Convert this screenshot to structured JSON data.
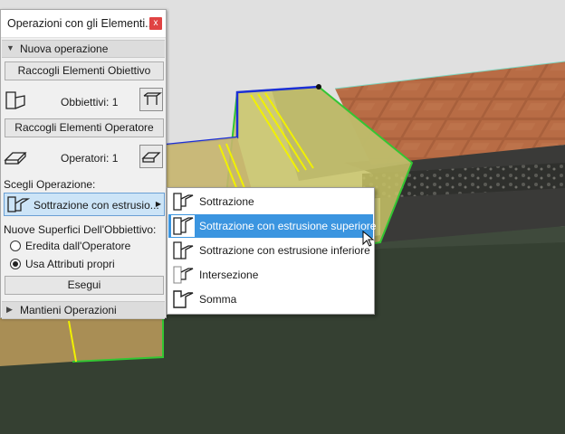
{
  "palette": {
    "title": "Operazioni con gli Elementi...",
    "close_glyph": "x",
    "section_new": "Nuova operazione",
    "collect_targets_button": "Raccogli Elementi Obiettivo",
    "targets_label": "Obbiettivi: 1",
    "collect_operators_button": "Raccogli Elementi Operatore",
    "operators_label": "Operatori: 1",
    "choose_operation_label": "Scegli Operazione:",
    "operation_selected": "Sottrazione con estrusio...",
    "new_surfaces_label": "Nuove Superfici Dell'Obbiettivo:",
    "radio_inherit": "Eredita dall'Operatore",
    "radio_own": "Usa Attributi propri",
    "radio_selected": "own",
    "execute_button": "Esegui",
    "section_keep": "Mantieni Operazioni"
  },
  "menu": {
    "items": [
      {
        "label": "Sottrazione",
        "icon": "subtraction-icon"
      },
      {
        "label": "Sottrazione con estrusione superiore",
        "icon": "subtraction-upward-extrusion-icon"
      },
      {
        "label": "Sottrazione con estrusione inferiore",
        "icon": "subtraction-downward-extrusion-icon"
      },
      {
        "label": "Intersezione",
        "icon": "intersection-icon"
      },
      {
        "label": "Somma",
        "icon": "union-icon"
      }
    ],
    "selected_index": 1
  },
  "colors": {
    "menu_highlight": "#3b95e0",
    "dropdown_highlight": "#cce4f7",
    "close_button": "#e04343",
    "slab_green": "#33c633",
    "roof_tile": "#b5653e"
  }
}
